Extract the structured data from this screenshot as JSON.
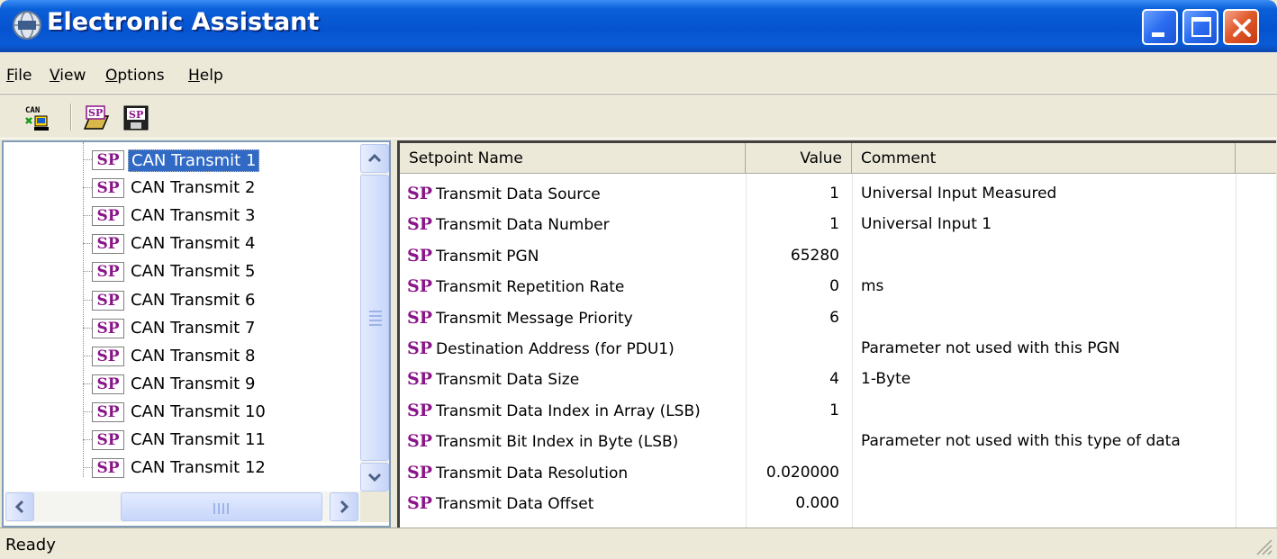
{
  "window": {
    "title": "Electronic Assistant",
    "icon": "app-globe-icon",
    "controls": [
      "minimize",
      "maximize",
      "close"
    ]
  },
  "menu": [
    {
      "label": "File",
      "mnemonic": "F",
      "rest": "ile"
    },
    {
      "label": "View",
      "mnemonic": "V",
      "rest": "iew"
    },
    {
      "label": "Options",
      "mnemonic": "O",
      "rest": "ptions"
    },
    {
      "label": "Help",
      "mnemonic": "H",
      "rest": "elp"
    }
  ],
  "toolbar": {
    "can_label": "CAN",
    "sp_label": "SP",
    "tools": [
      "can-connect-icon",
      "open-setpoint-file-icon",
      "save-setpoint-file-icon"
    ]
  },
  "tree": {
    "icon_text": "SP",
    "selected_index": 0,
    "items": [
      "CAN Transmit 1",
      "CAN Transmit 2",
      "CAN Transmit 3",
      "CAN Transmit 4",
      "CAN Transmit 5",
      "CAN Transmit 6",
      "CAN Transmit 7",
      "CAN Transmit 8",
      "CAN Transmit 9",
      "CAN Transmit 10",
      "CAN Transmit 11",
      "CAN Transmit 12"
    ]
  },
  "grid": {
    "columns": {
      "name": "Setpoint Name",
      "value": "Value",
      "comment": "Comment"
    },
    "sp_text": "SP",
    "rows": [
      {
        "name": "Transmit Data Source",
        "value": "1",
        "comment": "Universal Input Measured"
      },
      {
        "name": "Transmit Data Number",
        "value": "1",
        "comment": "Universal Input 1"
      },
      {
        "name": "Transmit PGN",
        "value": "65280",
        "comment": ""
      },
      {
        "name": "Transmit Repetition Rate",
        "value": "0",
        "comment": "ms"
      },
      {
        "name": "Transmit Message Priority",
        "value": "6",
        "comment": ""
      },
      {
        "name": "Destination Address (for PDU1)",
        "value": "",
        "comment": "Parameter not used with this PGN"
      },
      {
        "name": "Transmit Data Size",
        "value": "4",
        "comment": "1-Byte"
      },
      {
        "name": "Transmit Data Index in Array (LSB)",
        "value": "1",
        "comment": ""
      },
      {
        "name": "Transmit Bit Index in Byte (LSB)",
        "value": "",
        "comment": "Parameter not used with this type of data"
      },
      {
        "name": "Transmit Data Resolution",
        "value": "0.020000",
        "comment": ""
      },
      {
        "name": "Transmit Data Offset",
        "value": "0.000",
        "comment": ""
      }
    ]
  },
  "status": {
    "text": "Ready"
  },
  "colors": {
    "title_blue": "#0653d0",
    "selection": "#316ac5",
    "sp_purple": "#8a1489",
    "face": "#ece9d8"
  }
}
